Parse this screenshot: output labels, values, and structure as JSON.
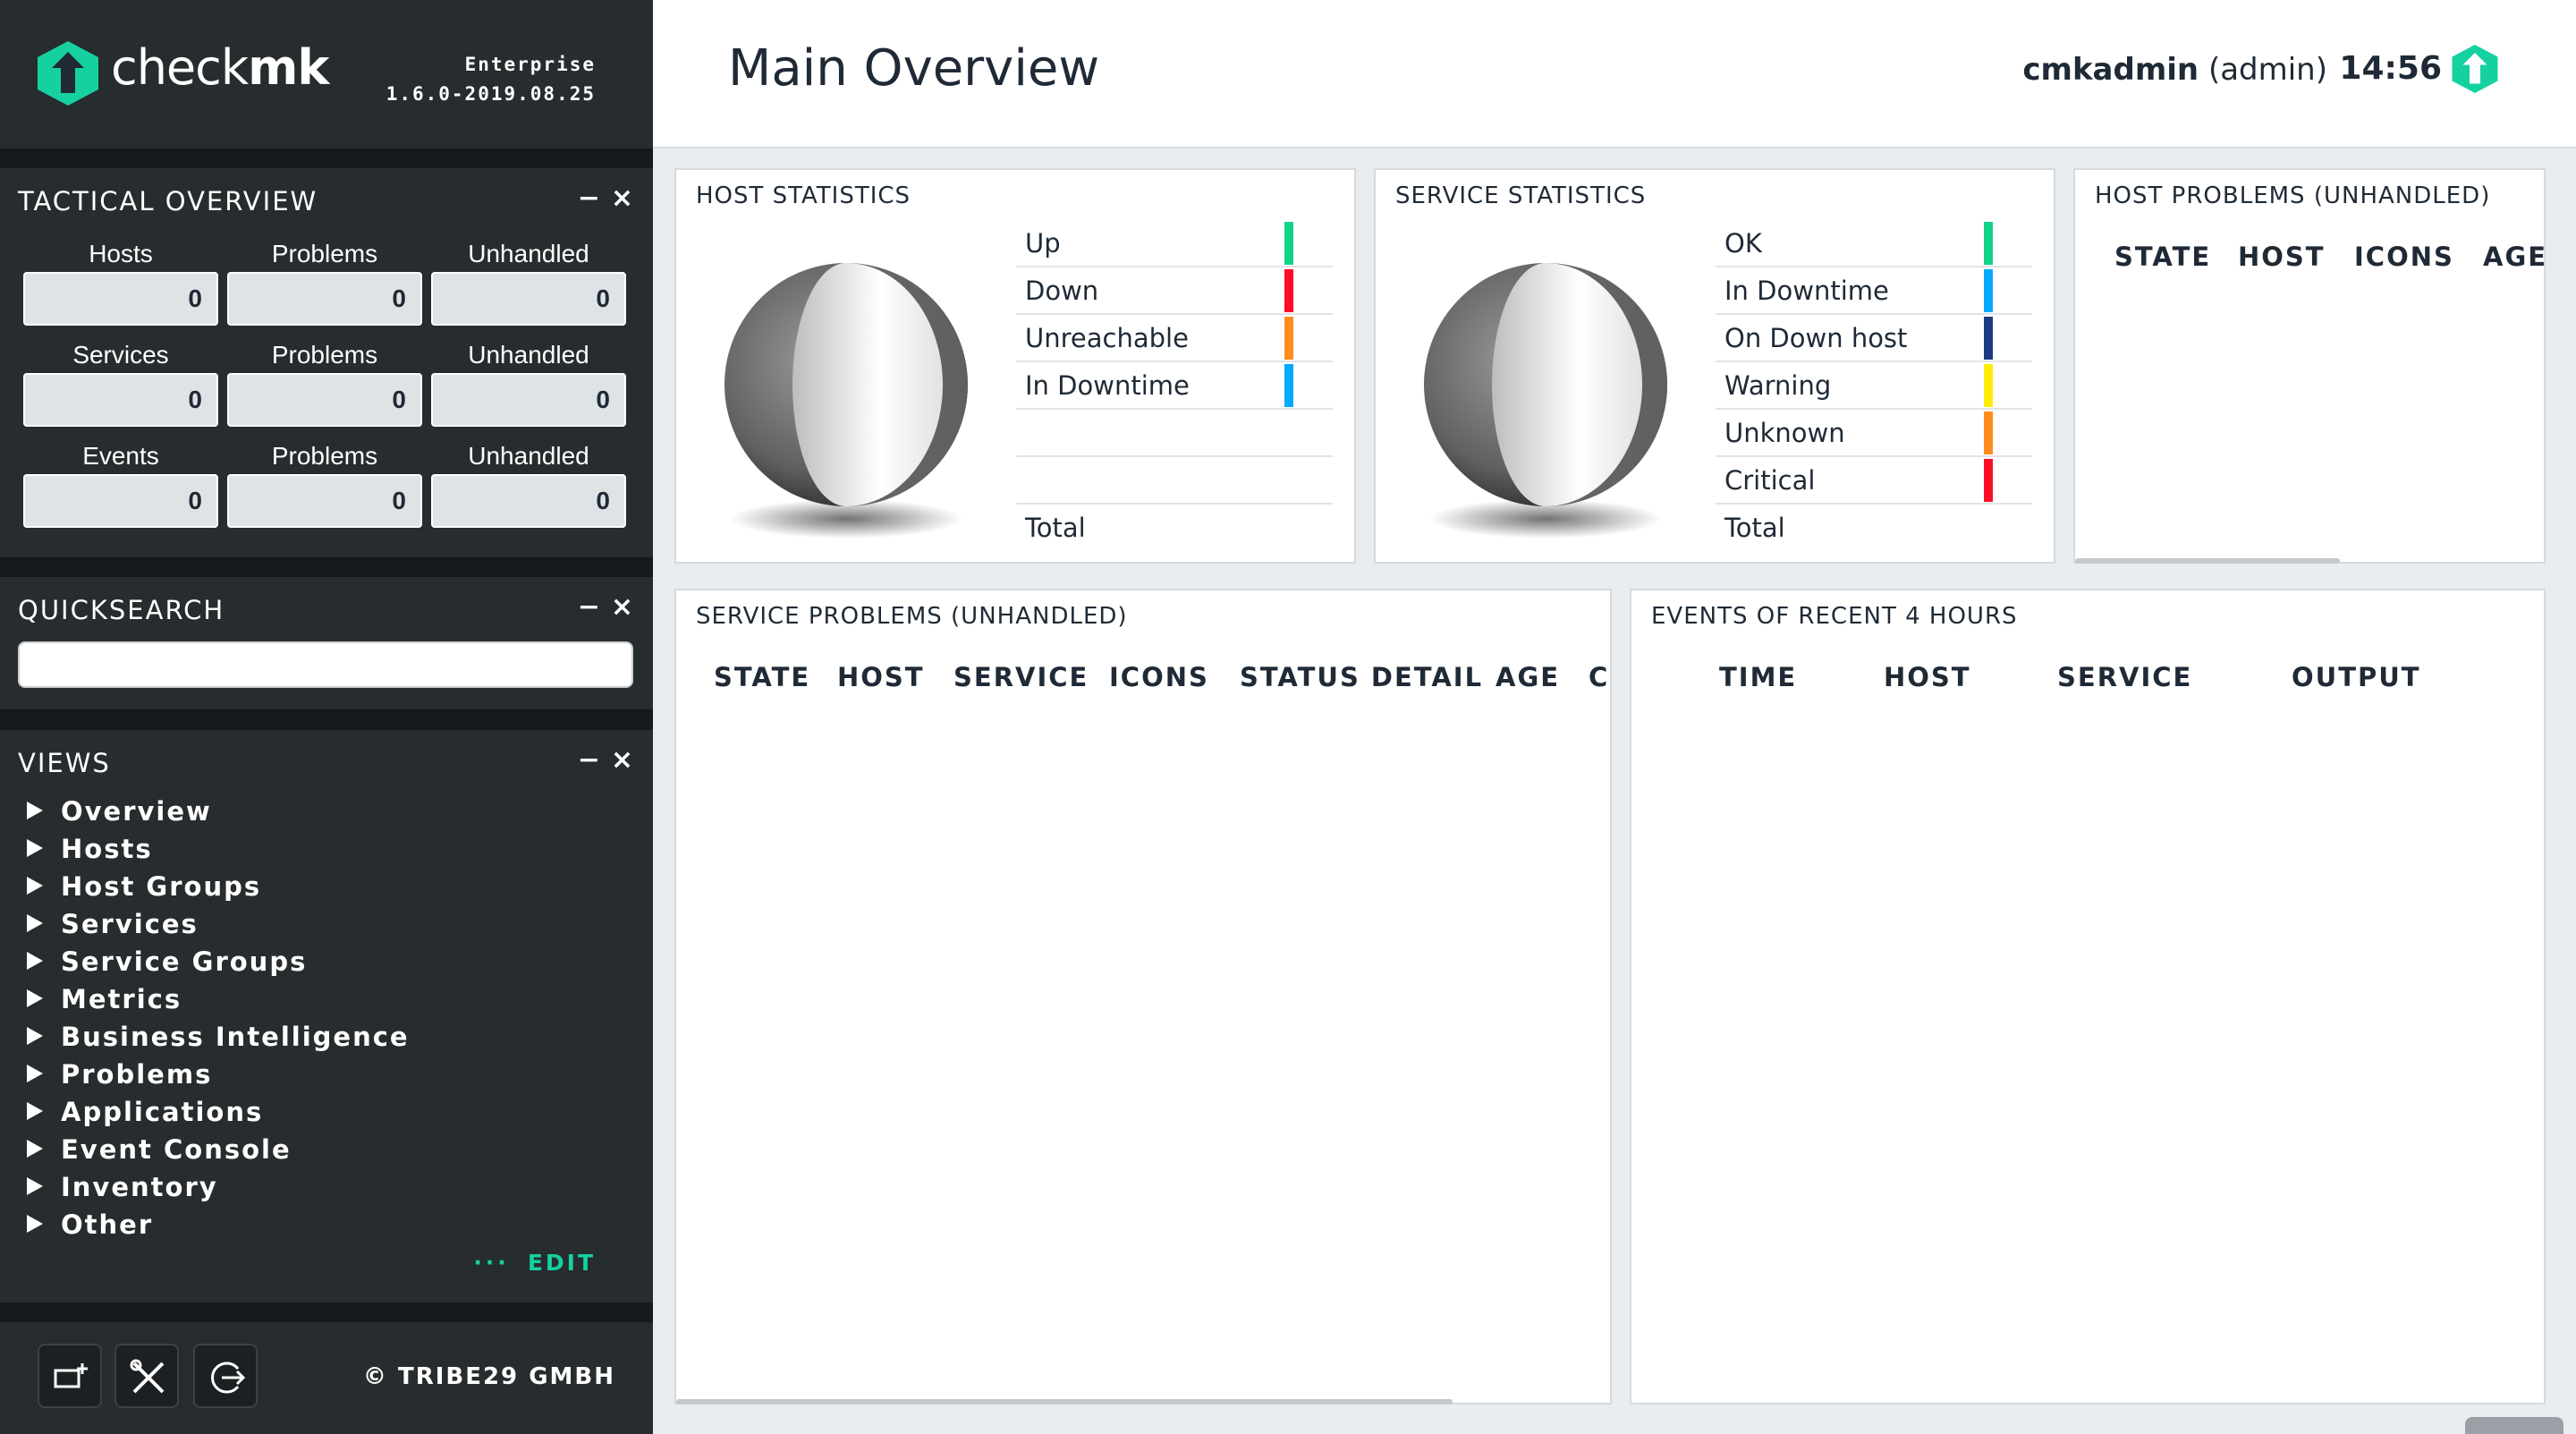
{
  "sidebar": {
    "logo_text_light": "check",
    "logo_text_bold": "mk",
    "edition": "Enterprise",
    "version": "1.6.0-2019.08.25",
    "snapin_controls": {
      "minimize": "−",
      "close": "×"
    },
    "tactical": {
      "title": "TACTICAL OVERVIEW",
      "rows": [
        {
          "labels": [
            "Hosts",
            "Problems",
            "Unhandled"
          ],
          "values": [
            "0",
            "0",
            "0"
          ]
        },
        {
          "labels": [
            "Services",
            "Problems",
            "Unhandled"
          ],
          "values": [
            "0",
            "0",
            "0"
          ]
        },
        {
          "labels": [
            "Events",
            "Problems",
            "Unhandled"
          ],
          "values": [
            "0",
            "0",
            "0"
          ]
        }
      ]
    },
    "quicksearch": {
      "title": "QUICKSEARCH",
      "placeholder": ""
    },
    "views": {
      "title": "VIEWS",
      "items": [
        "Overview",
        "Hosts",
        "Host Groups",
        "Services",
        "Service Groups",
        "Metrics",
        "Business Intelligence",
        "Problems",
        "Applications",
        "Event Console",
        "Inventory",
        "Other"
      ],
      "edit_dots": "···",
      "edit_label": "EDIT"
    },
    "footer": {
      "buttons": [
        "add-snapin-icon",
        "tools-icon",
        "logout-icon"
      ],
      "copyright": "© TRIBE29 GMBH"
    }
  },
  "topbar": {
    "title": "Main Overview",
    "user_name": "cmkadmin",
    "user_role": "(admin)",
    "time": "14:56"
  },
  "dashlets": {
    "host_stats": {
      "title": "HOST STATISTICS",
      "rows": [
        {
          "label": "Up",
          "color": "#13d389"
        },
        {
          "label": "Down",
          "color": "#ff0c25"
        },
        {
          "label": "Unreachable",
          "color": "#ff8c1c"
        },
        {
          "label": "In Downtime",
          "color": "#00aaff"
        },
        {
          "label": "",
          "color": ""
        },
        {
          "label": "",
          "color": ""
        },
        {
          "label": "Total",
          "color": ""
        }
      ]
    },
    "service_stats": {
      "title": "SERVICE STATISTICS",
      "rows": [
        {
          "label": "OK",
          "color": "#13d389"
        },
        {
          "label": "In Downtime",
          "color": "#00aaff"
        },
        {
          "label": "On Down host",
          "color": "#1e3a82"
        },
        {
          "label": "Warning",
          "color": "#ffee00"
        },
        {
          "label": "Unknown",
          "color": "#ff8c1c"
        },
        {
          "label": "Critical",
          "color": "#ff0c25"
        },
        {
          "label": "Total",
          "color": ""
        }
      ]
    },
    "host_problems": {
      "title": "HOST PROBLEMS (UNHANDLED)",
      "columns": [
        "STATE",
        "HOST",
        "ICONS",
        "AGE"
      ]
    },
    "service_problems": {
      "title": "SERVICE PROBLEMS (UNHANDLED)",
      "columns": [
        "STATE",
        "HOST",
        "SERVICE",
        "ICONS",
        "STATUS DETAIL",
        "AGE",
        "C"
      ]
    },
    "events": {
      "title": "EVENTS OF RECENT 4 HOURS",
      "columns": [
        "TIME",
        "HOST",
        "SERVICE",
        "OUTPUT"
      ]
    }
  },
  "colors": {
    "brand_green": "#15d1a0",
    "sidebar_bg": "#272c2e",
    "dark_bg": "#16191b"
  }
}
